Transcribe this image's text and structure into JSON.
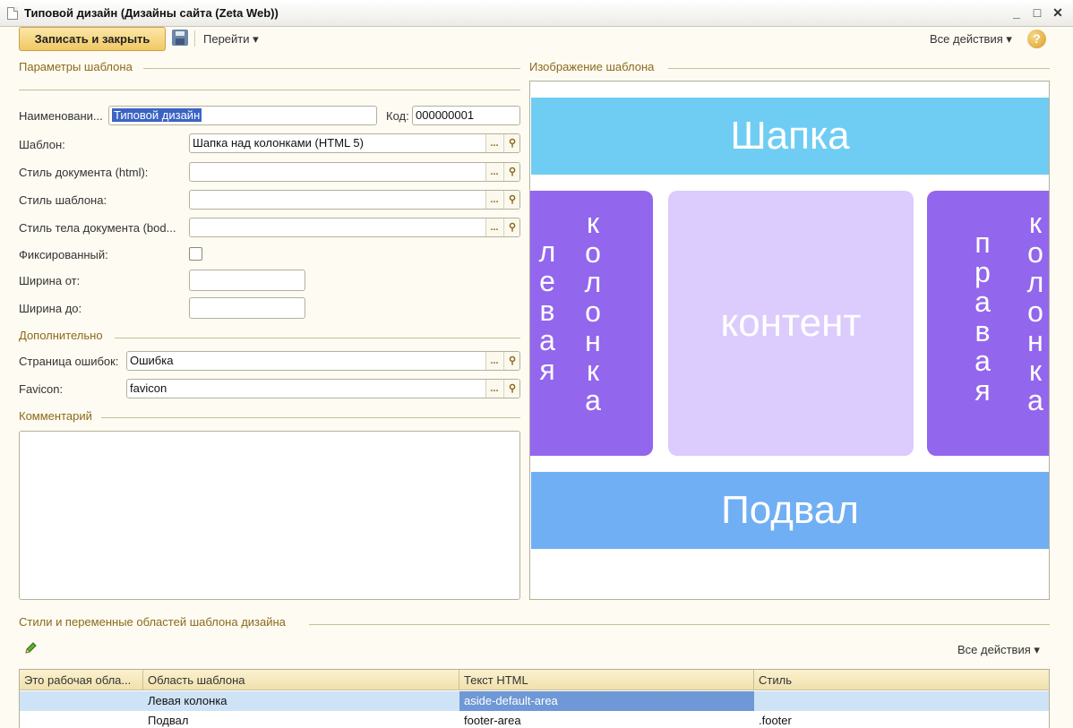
{
  "window": {
    "title": "Типовой дизайн (Дизайны сайта (Zeta Web))",
    "minimize": "_",
    "maximize": "□",
    "close": "✕"
  },
  "toolbar": {
    "save_close_label": "Записать и закрыть",
    "goto_label": "Перейти ▾",
    "all_actions_label": "Все действия ▾",
    "help_label": "?"
  },
  "params": {
    "group_title": "Параметры шаблона",
    "name_label": "Наименовани...",
    "name_value": "Типовой дизайн",
    "code_label": "Код:",
    "code_value": "000000001",
    "template_label": "Шаблон:",
    "template_value": "Шапка над колонками (HTML 5)",
    "doc_style_label": "Стиль документа (html):",
    "doc_style_value": "",
    "template_style_label": "Стиль шаблона:",
    "template_style_value": "",
    "body_style_label": "Стиль тела документа (bod...",
    "body_style_value": "",
    "fixed_label": "Фиксированный:",
    "fixed_checked": false,
    "width_from_label": "Ширина от:",
    "width_from_value": "",
    "width_to_label": "Ширина до:",
    "width_to_value": ""
  },
  "additional": {
    "group_title": "Дополнительно",
    "error_page_label": "Страница ошибок:",
    "error_page_value": "Ошибка",
    "favicon_label": "Favicon:",
    "favicon_value": "favicon"
  },
  "comment": {
    "group_title": "Комментарий",
    "value": ""
  },
  "preview": {
    "group_title": "Изображение шаблона",
    "header_text": "Шапка",
    "content_text": "контент",
    "footer_text": "Подвал",
    "left_col_word1": "левая",
    "left_col_word2": "колонка",
    "right_col_word1": "правая",
    "right_col_word2": "колонка",
    "colors": {
      "header": "#6fcdf4",
      "columns": "#9366ee",
      "content": "#dccbfd",
      "footer": "#70aff4"
    }
  },
  "styles_section": {
    "group_title": "Стили и переменные областей шаблона дизайна",
    "edit_icon": "pencil-icon",
    "all_actions_label": "Все действия ▾",
    "columns": [
      "Это рабочая обла...",
      "Область шаблона",
      "Текст HTML",
      "Стиль"
    ],
    "rows": [
      {
        "working": "",
        "area": "Левая колонка",
        "html": "aside-default-area",
        "style": ""
      },
      {
        "working": "",
        "area": "Подвал",
        "html": "footer-area",
        "style": ".footer"
      }
    ]
  }
}
